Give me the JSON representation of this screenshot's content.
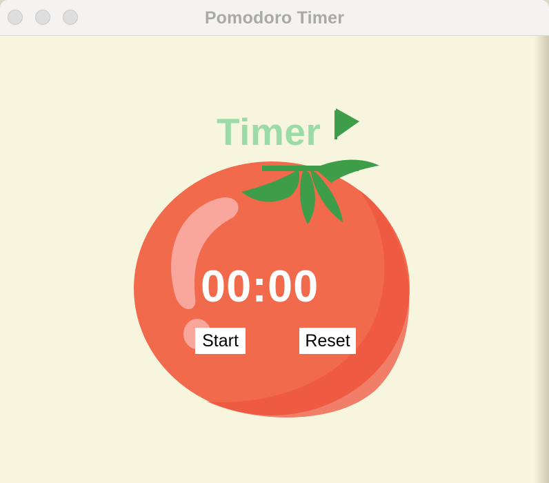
{
  "window": {
    "title": "Pomodoro Timer"
  },
  "timer": {
    "heading": "Timer",
    "display": "00:00"
  },
  "buttons": {
    "start": "Start",
    "reset": "Reset"
  },
  "colors": {
    "background": "#f8f5de",
    "heading": "#9bdba8",
    "tomato": "#f26a4c",
    "leaf": "#3e9d49",
    "display_text": "#ffffff"
  },
  "icons": {
    "tomato": "tomato-icon",
    "flag": "flag-icon"
  }
}
